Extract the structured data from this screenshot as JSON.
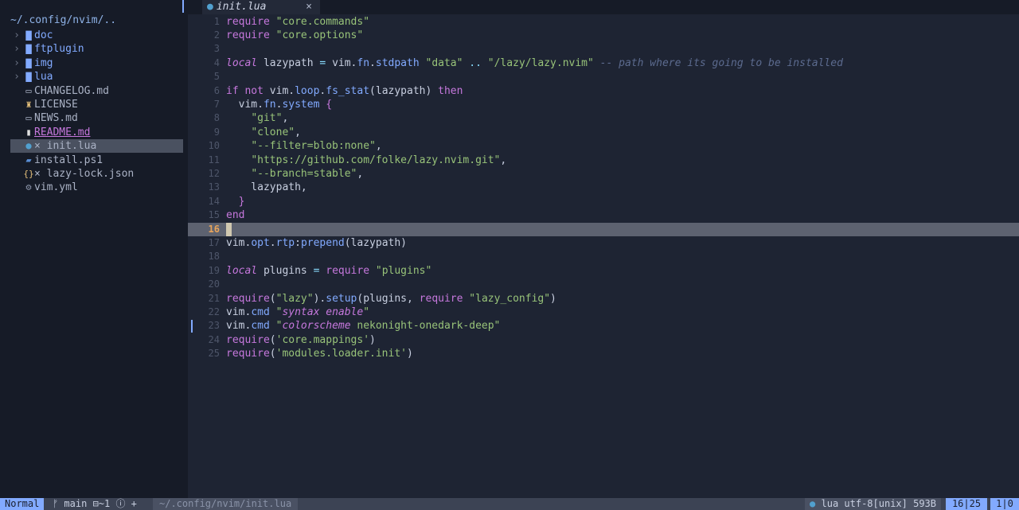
{
  "sidebar": {
    "root": "~/.config/nvim/..",
    "items": [
      {
        "name": "doc",
        "kind": "dir"
      },
      {
        "name": "ftplugin",
        "kind": "dir"
      },
      {
        "name": "img",
        "kind": "dir"
      },
      {
        "name": "lua",
        "kind": "dir"
      },
      {
        "name": "CHANGELOG.md",
        "kind": "md"
      },
      {
        "name": "LICENSE",
        "kind": "license"
      },
      {
        "name": "NEWS.md",
        "kind": "md"
      },
      {
        "name": "README.md",
        "kind": "readme"
      },
      {
        "name": "init.lua",
        "kind": "lua",
        "modified": "×"
      },
      {
        "name": "install.ps1",
        "kind": "ps1"
      },
      {
        "name": "lazy-lock.json",
        "kind": "json",
        "modified": "×"
      },
      {
        "name": "vim.yml",
        "kind": "yml"
      }
    ]
  },
  "tab": {
    "name": "init.lua",
    "close": "×"
  },
  "editor": {
    "current_line": 16,
    "lines": [
      [
        [
          "kw",
          "require"
        ],
        [
          "tx",
          " "
        ],
        [
          "str",
          "\"core.commands\""
        ]
      ],
      [
        [
          "kw",
          "require"
        ],
        [
          "tx",
          " "
        ],
        [
          "str",
          "\"core.options\""
        ]
      ],
      [],
      [
        [
          "kwi",
          "local"
        ],
        [
          "tx",
          " lazypath "
        ],
        [
          "op",
          "="
        ],
        [
          "tx",
          " vim."
        ],
        [
          "fn",
          "fn"
        ],
        [
          "tx",
          "."
        ],
        [
          "fn",
          "stdpath"
        ],
        [
          "tx",
          " "
        ],
        [
          "str",
          "\"data\""
        ],
        [
          "tx",
          " "
        ],
        [
          "op",
          ".."
        ],
        [
          "tx",
          " "
        ],
        [
          "str",
          "\"/lazy/lazy.nvim\""
        ],
        [
          "tx",
          " "
        ],
        [
          "cm",
          "-- path where its going to be installed"
        ]
      ],
      [],
      [
        [
          "kw",
          "if"
        ],
        [
          "tx",
          " "
        ],
        [
          "kw",
          "not"
        ],
        [
          "tx",
          " vim."
        ],
        [
          "fn",
          "loop"
        ],
        [
          "tx",
          "."
        ],
        [
          "fn",
          "fs_stat"
        ],
        [
          "tx",
          "(lazypath) "
        ],
        [
          "kw",
          "then"
        ]
      ],
      [
        [
          "tx",
          "  vim."
        ],
        [
          "fn",
          "fn"
        ],
        [
          "tx",
          "."
        ],
        [
          "fn",
          "system"
        ],
        [
          "tx",
          " "
        ],
        [
          "br",
          "{"
        ]
      ],
      [
        [
          "tx",
          "    "
        ],
        [
          "str",
          "\"git\""
        ],
        [
          "tx",
          ","
        ]
      ],
      [
        [
          "tx",
          "    "
        ],
        [
          "str",
          "\"clone\""
        ],
        [
          "tx",
          ","
        ]
      ],
      [
        [
          "tx",
          "    "
        ],
        [
          "str",
          "\"--filter=blob:none\""
        ],
        [
          "tx",
          ","
        ]
      ],
      [
        [
          "tx",
          "    "
        ],
        [
          "str",
          "\"https://github.com/folke/lazy.nvim.git\""
        ],
        [
          "tx",
          ","
        ]
      ],
      [
        [
          "tx",
          "    "
        ],
        [
          "str",
          "\"--branch=stable\""
        ],
        [
          "tx",
          ","
        ]
      ],
      [
        [
          "tx",
          "    lazypath,"
        ]
      ],
      [
        [
          "tx",
          "  "
        ],
        [
          "br",
          "}"
        ]
      ],
      [
        [
          "kw",
          "end"
        ]
      ],
      [],
      [
        [
          "tx",
          "vim."
        ],
        [
          "fn",
          "opt"
        ],
        [
          "tx",
          "."
        ],
        [
          "fn",
          "rtp"
        ],
        [
          "tx",
          ":"
        ],
        [
          "fn",
          "prepend"
        ],
        [
          "tx",
          "(lazypath)"
        ]
      ],
      [],
      [
        [
          "kwi",
          "local"
        ],
        [
          "tx",
          " plugins "
        ],
        [
          "op",
          "="
        ],
        [
          "tx",
          " "
        ],
        [
          "kw",
          "require"
        ],
        [
          "tx",
          " "
        ],
        [
          "str",
          "\"plugins\""
        ]
      ],
      [],
      [
        [
          "kw",
          "require"
        ],
        [
          "tx",
          "("
        ],
        [
          "str",
          "\"lazy\""
        ],
        [
          "tx",
          ")."
        ],
        [
          "fn",
          "setup"
        ],
        [
          "tx",
          "(plugins, "
        ],
        [
          "kw",
          "require"
        ],
        [
          "tx",
          " "
        ],
        [
          "str",
          "\"lazy_config\""
        ],
        [
          "tx",
          ")"
        ]
      ],
      [
        [
          "tx",
          "vim."
        ],
        [
          "fn",
          "cmd"
        ],
        [
          "tx",
          " "
        ],
        [
          "str",
          "\""
        ],
        [
          "stri",
          "syntax enable"
        ],
        [
          "str",
          "\""
        ]
      ],
      [
        [
          "tx",
          "vim."
        ],
        [
          "fn",
          "cmd"
        ],
        [
          "tx",
          " "
        ],
        [
          "str",
          "\""
        ],
        [
          "stri",
          "colorscheme"
        ],
        [
          "str",
          " nekonight-onedark-deep\""
        ]
      ],
      [
        [
          "kw",
          "require"
        ],
        [
          "tx",
          "("
        ],
        [
          "str",
          "'core.mappings'"
        ],
        [
          "tx",
          ")"
        ]
      ],
      [
        [
          "kw",
          "require"
        ],
        [
          "tx",
          "("
        ],
        [
          "str",
          "'modules.loader.init'"
        ],
        [
          "tx",
          ")"
        ]
      ]
    ]
  },
  "status": {
    "mode": "Normal",
    "branch": "ᚠ main",
    "changes": "⊟~1 ⓘ +",
    "path": "~/.config/nvim/init.lua",
    "filetype": "lua utf-8[unix] 593B",
    "position": "16|25",
    "column": "1|0"
  },
  "colors": {
    "accent": "#82aaff",
    "keyword": "#c678dd",
    "string": "#98c379",
    "comment": "#5c6b8f"
  }
}
